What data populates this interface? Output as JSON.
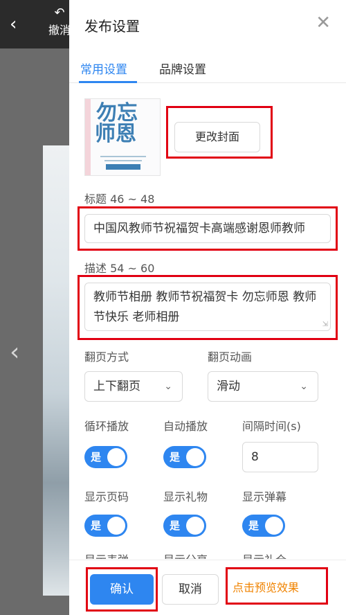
{
  "editor": {
    "back_icon": "chevron-left-icon",
    "undo_icon": "undo-icon",
    "undo_label": "撤消"
  },
  "panel": {
    "title": "发布设置",
    "close_icon": "close-icon",
    "tabs": [
      {
        "label": "常用设置",
        "active": true
      },
      {
        "label": "品牌设置",
        "active": false
      }
    ]
  },
  "cover": {
    "thumb_text_1": "勿忘",
    "thumb_text_2": "师恩",
    "change_button": "更改封面"
  },
  "title_field": {
    "label": "标题 46 ~ 48",
    "value": "中国风教师节祝福贺卡高端感谢恩师教师"
  },
  "desc_field": {
    "label": "描述 54 ~ 60",
    "value": "教师节相册 教师节祝福贺卡 勿忘师恩 教师节快乐 老师相册"
  },
  "page_mode": {
    "label": "翻页方式",
    "value": "上下翻页"
  },
  "page_anim": {
    "label": "翻页动画",
    "value": "滑动"
  },
  "loop": {
    "label": "循环播放",
    "state": "是"
  },
  "autoplay": {
    "label": "自动播放",
    "state": "是"
  },
  "interval": {
    "label": "间隔时间(s)",
    "value": "8"
  },
  "show_page": {
    "label": "显示页码",
    "state": "是"
  },
  "show_gift": {
    "label": "显示礼物",
    "state": "是"
  },
  "show_danmaku": {
    "label": "显示弹幕",
    "state": "是"
  },
  "cut_labels": [
    "显示表弹",
    "显示分享",
    "显示礼仓"
  ],
  "footer": {
    "confirm": "确认",
    "cancel": "取消",
    "preview": "点击预览效果"
  },
  "colors": {
    "accent": "#2e86f0",
    "highlight": "#e10012",
    "preview": "#f08300"
  }
}
